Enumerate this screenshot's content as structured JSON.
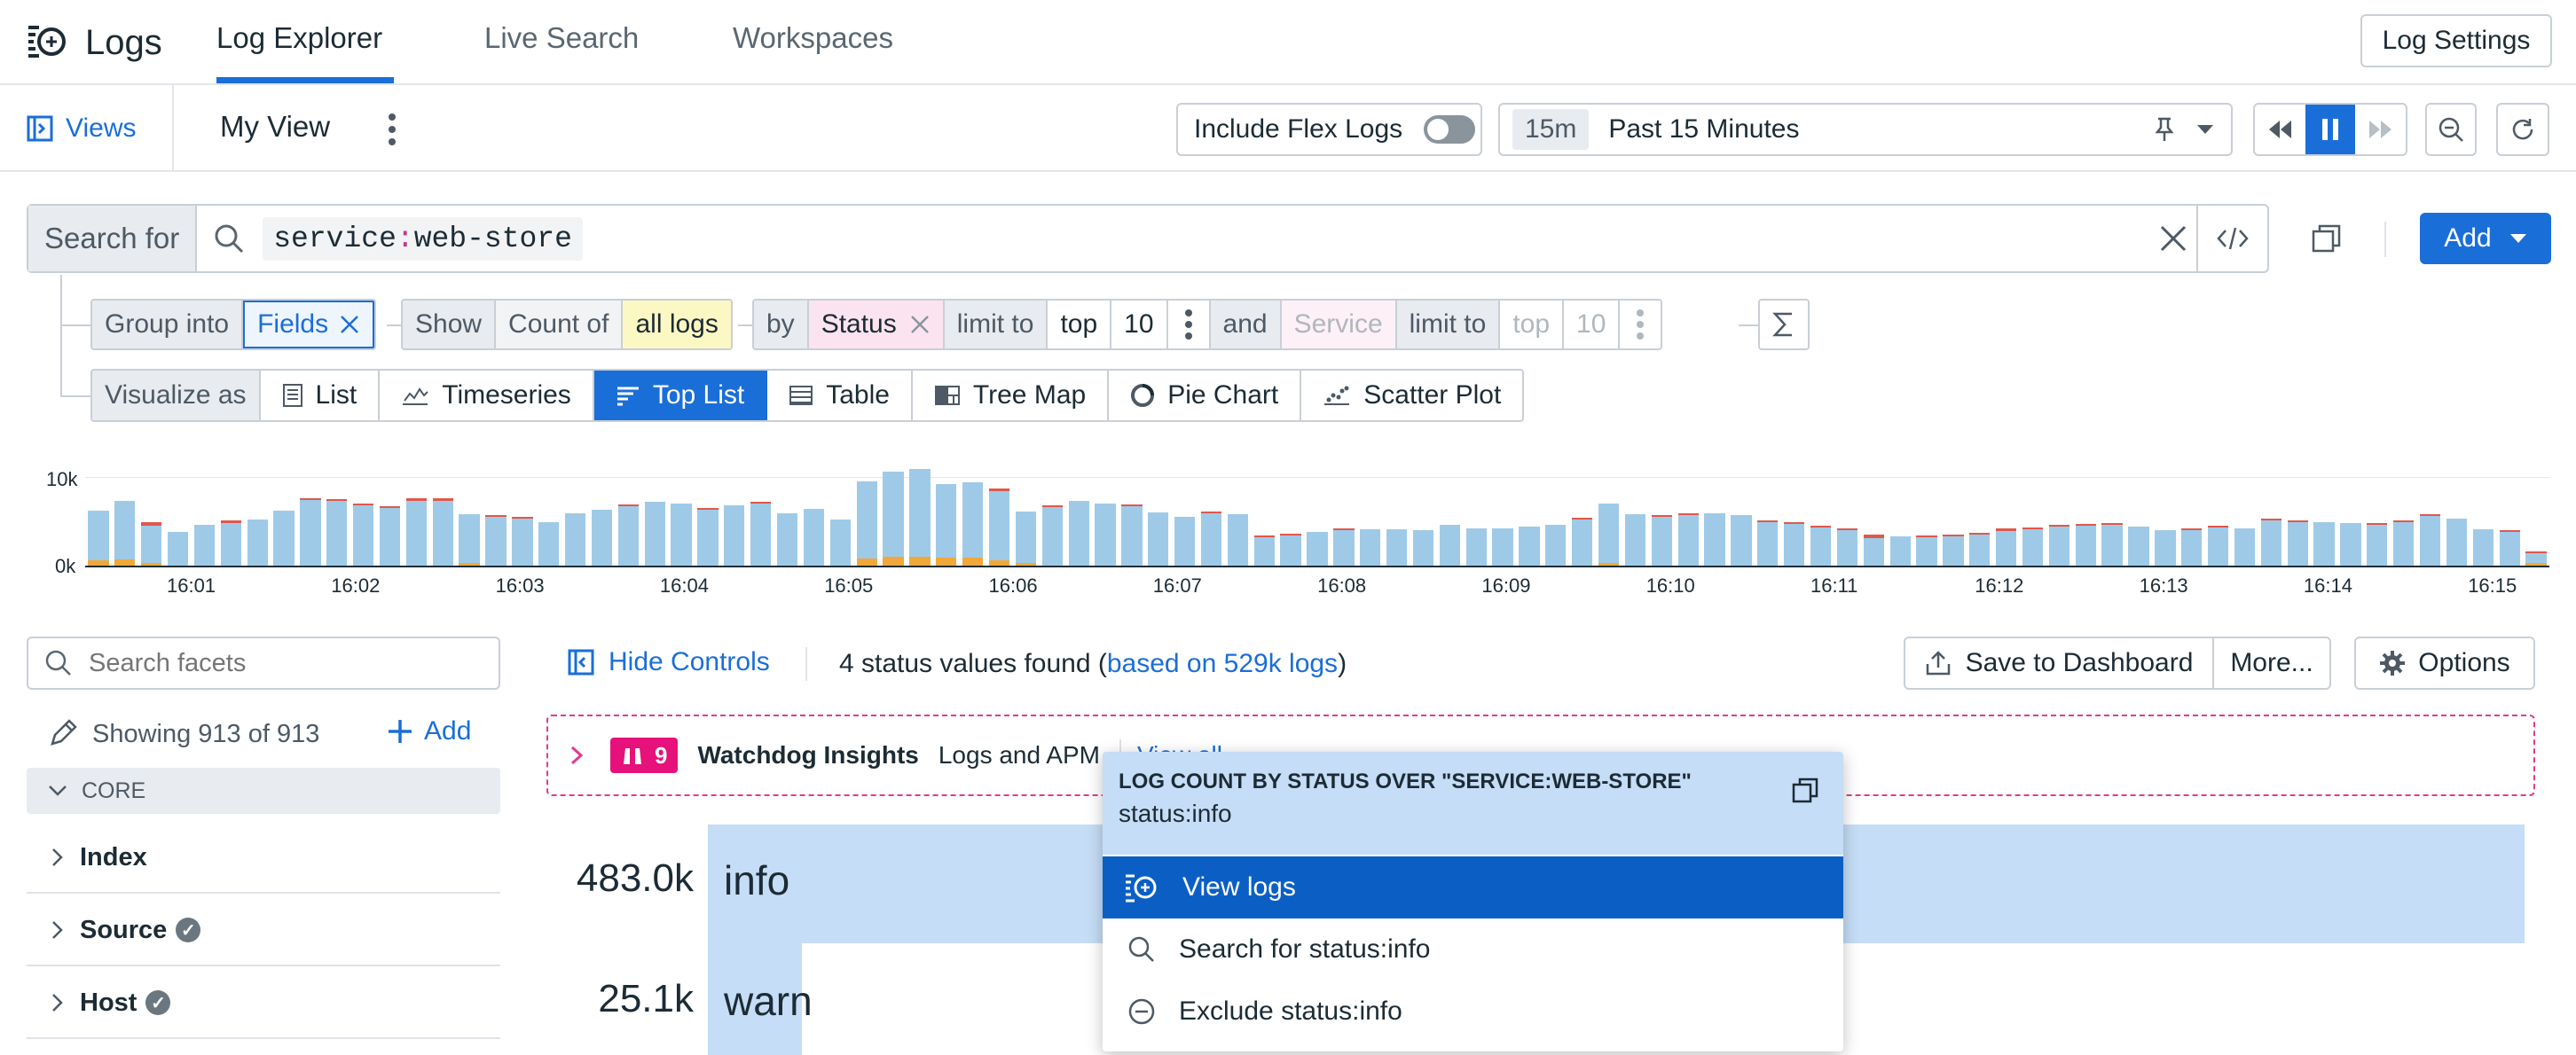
{
  "app": {
    "title": "Logs"
  },
  "tabs": [
    "Log Explorer",
    "Live Search",
    "Workspaces"
  ],
  "header": {
    "log_settings": "Log Settings"
  },
  "subheader": {
    "views": "Views",
    "view_name": "My View",
    "include_flex": "Include Flex Logs",
    "time_short": "15m",
    "time_label": "Past 15 Minutes"
  },
  "search": {
    "label": "Search for",
    "query_key": "service",
    "query_sep": ":",
    "query_val": "web-store",
    "add_label": "Add"
  },
  "groupby": {
    "group_into": "Group into",
    "fields": "Fields",
    "show": "Show",
    "count_of": "Count of",
    "all_logs": "all logs",
    "by": "by",
    "status": "Status",
    "limit_to": "limit to",
    "top": "top",
    "ten": "10",
    "and": "and",
    "service": "Service",
    "limit_to2": "limit to",
    "top2": "top",
    "ten2": "10"
  },
  "visualize": {
    "label": "Visualize as",
    "options": [
      "List",
      "Timeseries",
      "Top List",
      "Table",
      "Tree Map",
      "Pie Chart",
      "Scatter Plot"
    ],
    "selected": "Top List"
  },
  "chart_data": {
    "type": "bar",
    "ytick_labels": [
      "10k",
      "0k"
    ],
    "ylim": [
      0,
      10000
    ],
    "xtick_labels": [
      "16:01",
      "16:02",
      "16:03",
      "16:04",
      "16:05",
      "16:06",
      "16:07",
      "16:08",
      "16:09",
      "16:10",
      "16:11",
      "16:12",
      "16:13",
      "16:14",
      "16:15"
    ],
    "series": [
      {
        "color": "#9ecae8",
        "values": [
          5600,
          6600,
          4200,
          3800,
          4600,
          4800,
          5200,
          6200,
          7400,
          7300,
          6800,
          6500,
          7300,
          7300,
          5500,
          5500,
          5300,
          4900,
          5900,
          6300,
          6700,
          7200,
          7000,
          6300,
          6800,
          7000,
          5900,
          6400,
          5200,
          8700,
          9600,
          9900,
          8300,
          8500,
          7800,
          5800,
          6600,
          7300,
          7000,
          6700,
          6000,
          5500,
          5900,
          5800,
          3200,
          3400,
          3800,
          4000,
          4100,
          4100,
          4000,
          4600,
          4200,
          4200,
          4400,
          4600,
          5200,
          6700,
          5800,
          5500,
          5700,
          5900,
          5700,
          4900,
          4700,
          4300,
          4000,
          3100,
          3300,
          3200,
          3300,
          3500,
          3900,
          4100,
          4400,
          4500,
          4600,
          4400,
          4000,
          4000,
          4300,
          4200,
          5100,
          4900,
          4900,
          4800,
          4600,
          4900,
          5600,
          5300,
          4100,
          3800,
          1100
        ]
      },
      {
        "color": "#e0584a",
        "values": [
          0,
          0,
          400,
          0,
          0,
          300,
          0,
          0,
          200,
          200,
          200,
          200,
          300,
          300,
          0,
          200,
          200,
          0,
          0,
          0,
          200,
          0,
          0,
          200,
          0,
          200,
          0,
          0,
          0,
          0,
          0,
          0,
          0,
          0,
          300,
          0,
          200,
          0,
          0,
          200,
          0,
          0,
          200,
          0,
          200,
          200,
          0,
          200,
          0,
          0,
          0,
          0,
          0,
          0,
          0,
          0,
          200,
          0,
          0,
          200,
          200,
          0,
          0,
          200,
          200,
          200,
          200,
          400,
          0,
          200,
          200,
          200,
          300,
          200,
          200,
          200,
          200,
          0,
          0,
          200,
          200,
          0,
          200,
          200,
          0,
          0,
          200,
          200,
          200,
          0,
          0,
          200,
          200
        ]
      },
      {
        "color": "#f0a83c",
        "values": [
          600,
          700,
          300,
          0,
          0,
          0,
          0,
          0,
          0,
          0,
          0,
          0,
          0,
          0,
          300,
          0,
          0,
          0,
          0,
          0,
          0,
          0,
          0,
          0,
          0,
          0,
          0,
          0,
          0,
          800,
          1000,
          1000,
          900,
          900,
          600,
          300,
          0,
          0,
          0,
          0,
          0,
          0,
          0,
          0,
          0,
          0,
          0,
          0,
          0,
          0,
          0,
          0,
          0,
          0,
          0,
          0,
          0,
          300,
          0,
          0,
          0,
          0,
          0,
          0,
          0,
          0,
          0,
          0,
          0,
          0,
          0,
          0,
          0,
          0,
          0,
          0,
          0,
          0,
          0,
          0,
          0,
          0,
          0,
          0,
          0,
          0,
          0,
          0,
          0,
          0,
          0,
          0,
          300
        ]
      }
    ]
  },
  "facets": {
    "search_placeholder": "Search facets",
    "showing": "Showing 913 of 913",
    "add": "Add",
    "section": "CORE",
    "items": [
      "Index",
      "Source",
      "Host"
    ]
  },
  "controls": {
    "hide": "Hide Controls",
    "found": "4 status values found (",
    "based": "based on 529k logs",
    "close_paren": ")",
    "save_dash": "Save to Dashboard",
    "more": "More...",
    "options": "Options"
  },
  "watchdog": {
    "count": "9",
    "title": "Watchdog Insights",
    "sub": "Logs and APM",
    "view_all": "View all"
  },
  "toplist": [
    {
      "value": "483.0k",
      "label": "info",
      "fraction": 1.0
    },
    {
      "value": "25.1k",
      "label": "warn",
      "fraction": 0.052
    }
  ],
  "popup": {
    "title": "LOG COUNT BY STATUS OVER \"SERVICE:WEB-STORE\"",
    "subtitle": "status:info",
    "items": [
      "View logs",
      "Search for status:info",
      "Exclude status:info"
    ]
  }
}
